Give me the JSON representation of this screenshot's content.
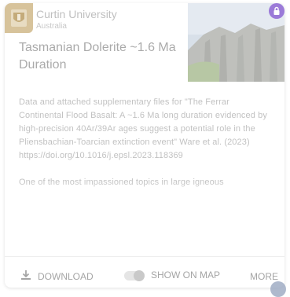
{
  "organization": {
    "name": "Curtin University",
    "country": "Australia"
  },
  "dataset": {
    "title": "Tasmanian Dolerite ~1.6 Ma Duration",
    "description_p1": "Data and attached supplementary files for \"The Ferrar Continental Flood Basalt: A ~1.6 Ma long duration evidenced by high-precision 40Ar/39Ar ages suggest a potential role in the Pliensbachian-Toarcian extinction event\" Ware et al. (2023) https://doi.org/10.1016/j.epsl.2023.118369",
    "description_p2": "One of the most impassioned topics in large igneous"
  },
  "footer": {
    "download_label": "DOWNLOAD",
    "show_on_map_label": "SHOW ON MAP",
    "more_label": "MORE"
  },
  "icons": {
    "logo": "university-crest-icon",
    "lock": "lock-icon",
    "download": "download-icon",
    "corner": "globe-icon"
  },
  "colors": {
    "logo_bg": "#d7c39b",
    "lock_bg": "#9b7ad8"
  }
}
